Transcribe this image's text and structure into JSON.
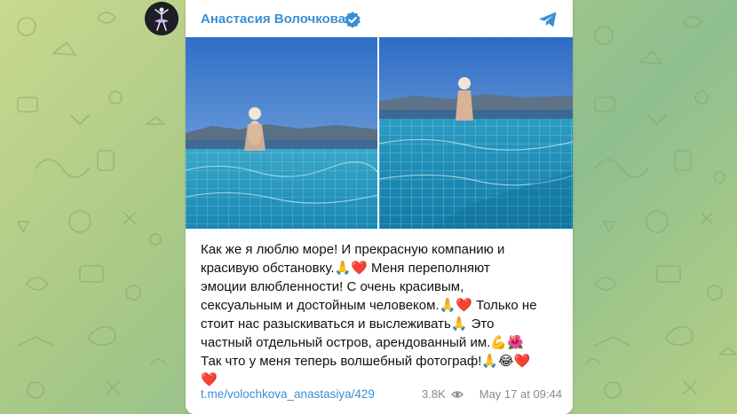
{
  "channel": {
    "name": "Анастасия Волочкова",
    "avatar_icon": "ballerina-silhouette-icon",
    "verified_icon": "verified-badge-icon",
    "share_icon": "telegram-share-icon"
  },
  "post": {
    "photos": [
      {
        "icon": "pool-photo-1"
      },
      {
        "icon": "pool-photo-2"
      }
    ],
    "text_lines": [
      "Как же я люблю море! И прекрасную компанию и",
      "красивую обстановку.🙏❤️ Меня переполняют",
      "эмоции влюбленности! С очень красивым,",
      "сексуальным и достойным человеком.🙏❤️ Только не",
      "стоит нас разыскиваться и выслеживать🙏 Это",
      "частный отдельный остров, арендованный им.💪🌺",
      "Так что у меня теперь волшебный фотограф!🙏😂❤️",
      "❤️"
    ],
    "link": "t.me/volochkova_anastasiya/429",
    "views": "3.8K",
    "date": "May 17 at 09:44"
  },
  "colors": {
    "accent": "#3a8fd4",
    "background": "#a9c987",
    "meta": "#8a8a8a"
  }
}
